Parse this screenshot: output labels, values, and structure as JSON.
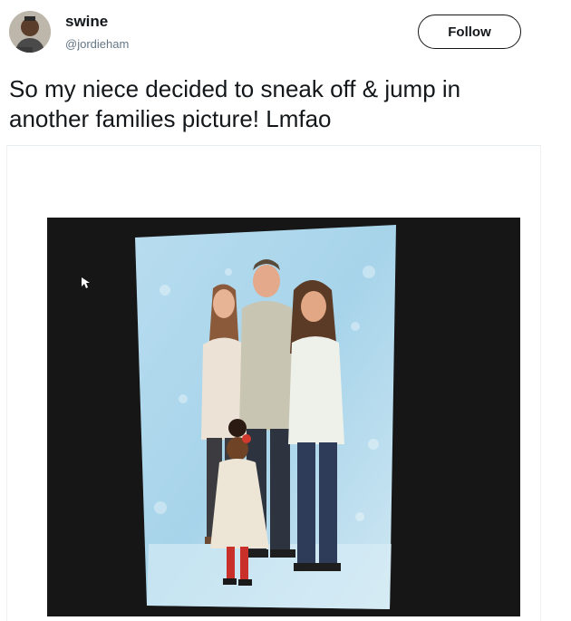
{
  "tweet": {
    "author": {
      "display_name": "swine",
      "handle": "@jordieham"
    },
    "follow_label": "Follow",
    "text_line1": "So my niece decided to sneak off & jump in",
    "text_line2": "another families picture! Lmfao"
  },
  "colors": {
    "text_primary": "#14171a",
    "text_secondary": "#657786",
    "backdrop_blue": "#a9d6ea"
  },
  "icons": {
    "mouse_cursor": "cursor-arrow-icon"
  }
}
